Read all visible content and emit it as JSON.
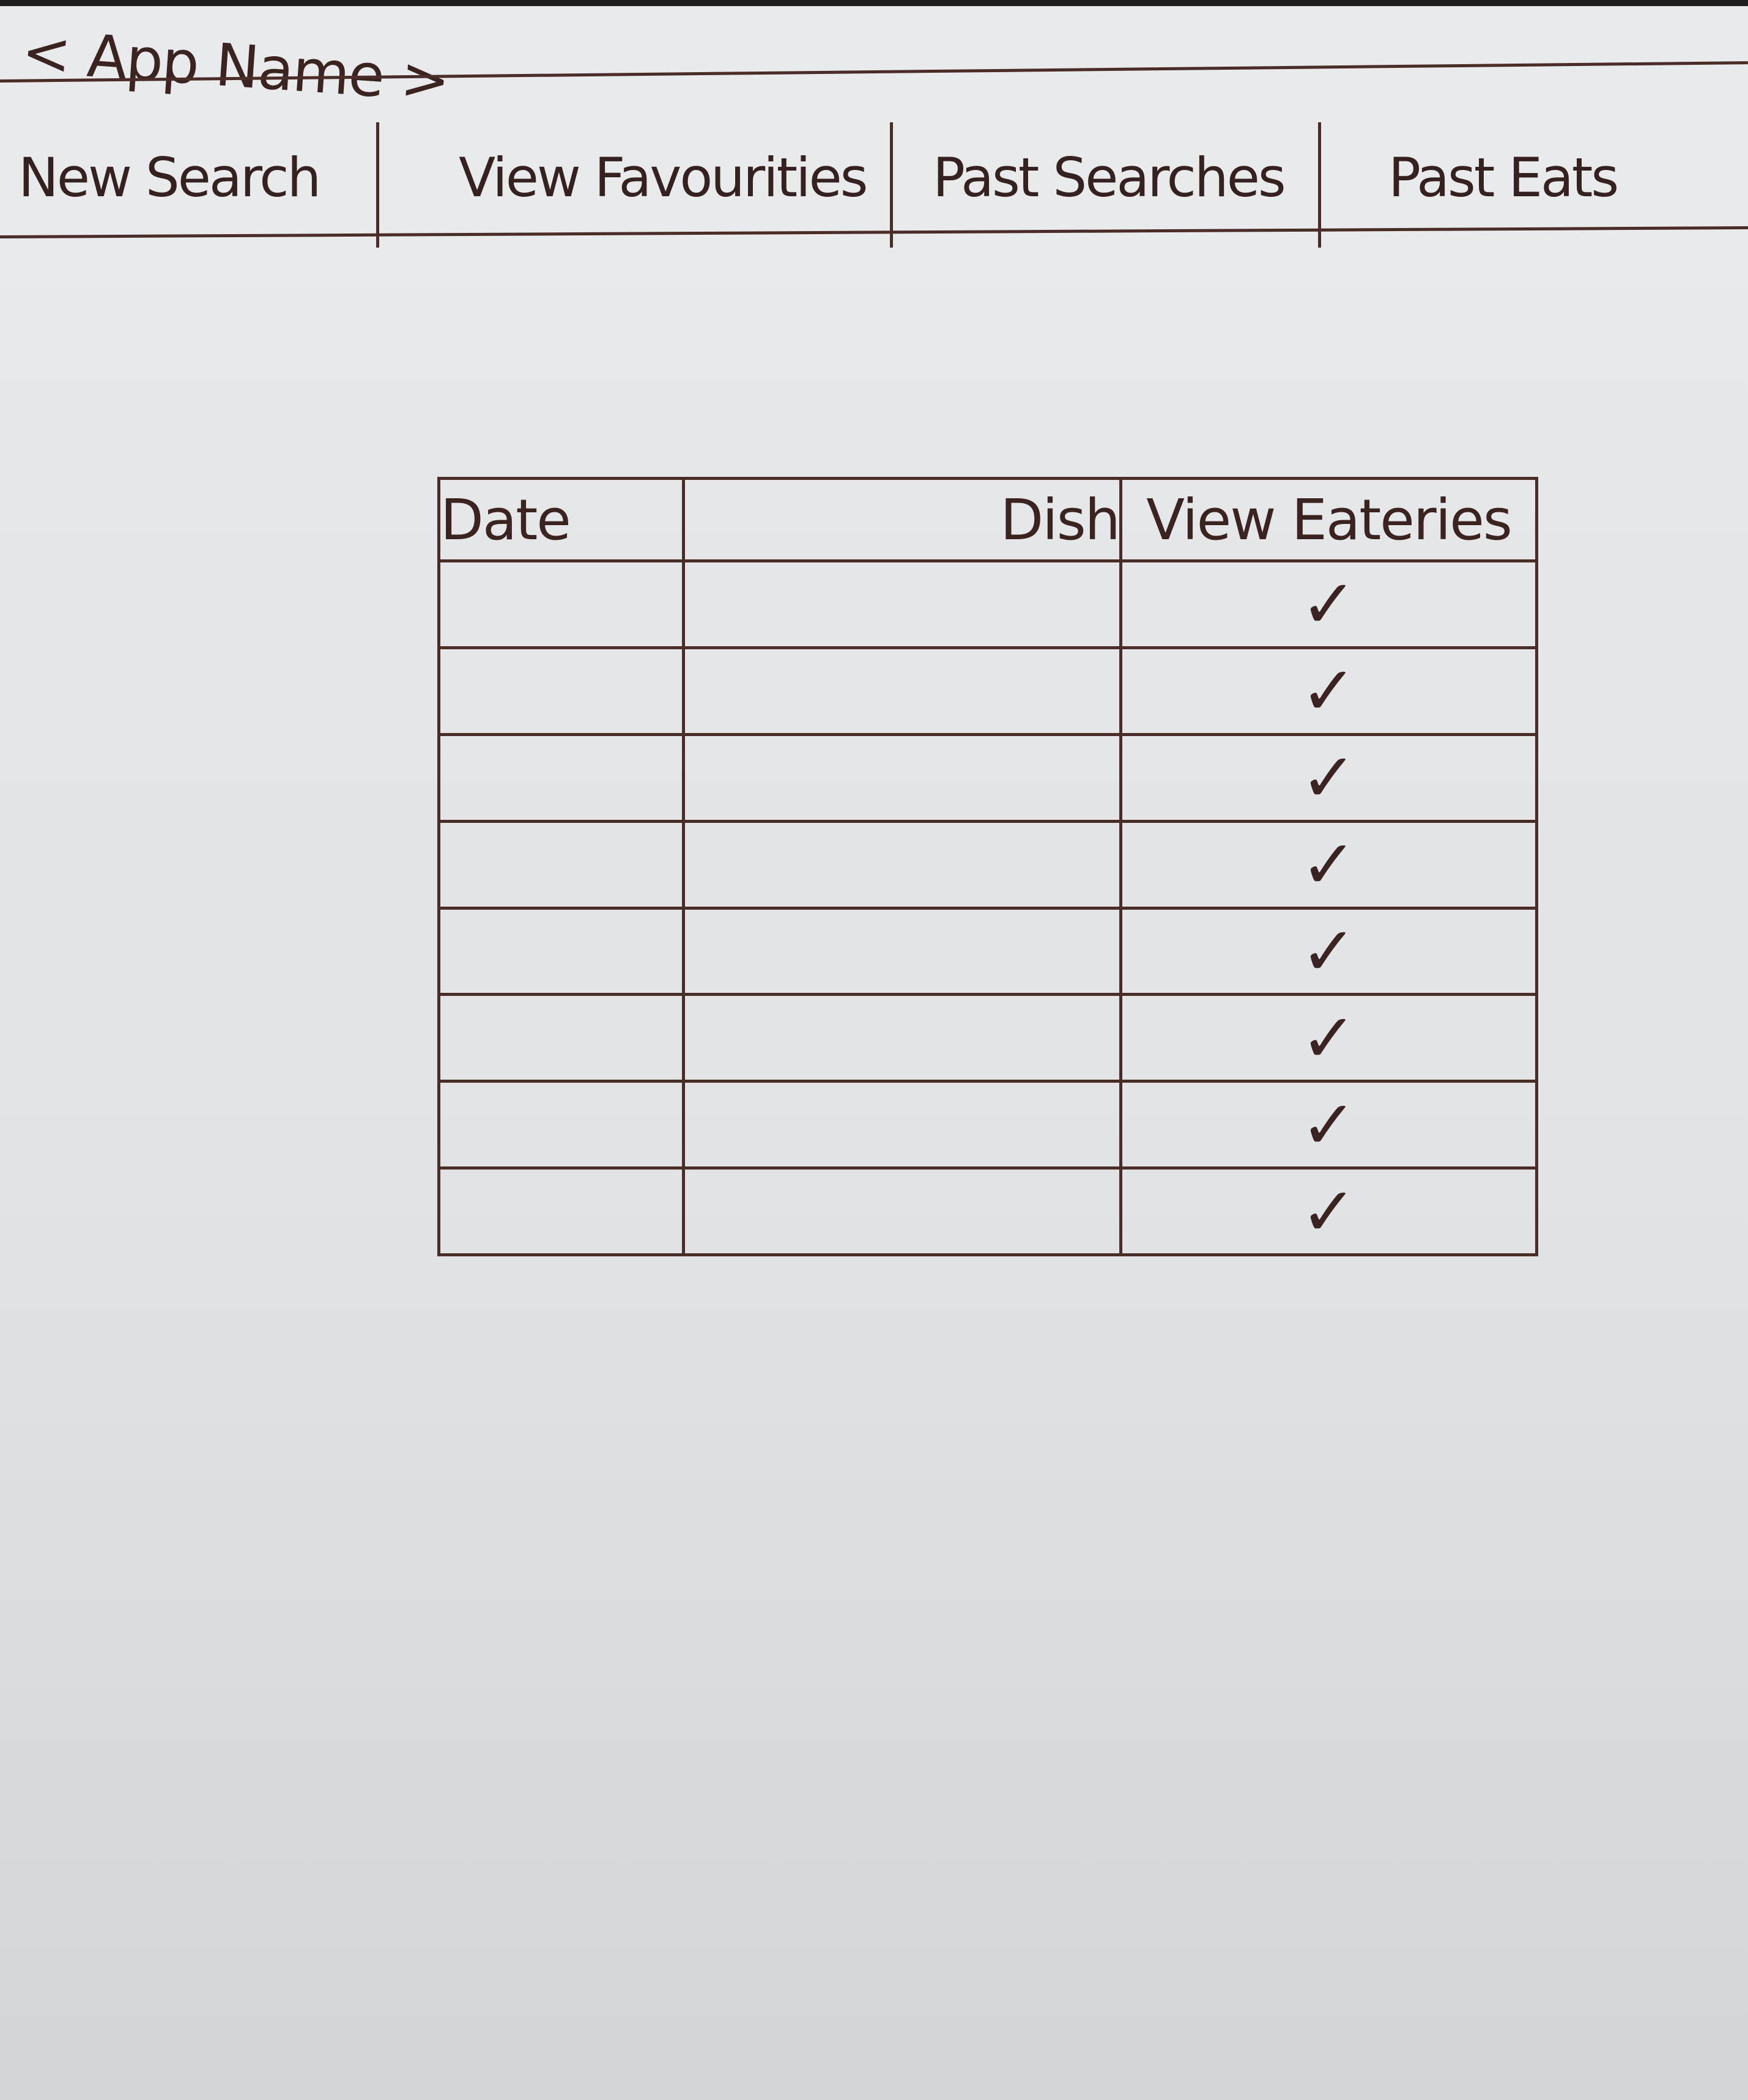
{
  "app": {
    "name": "< App Name >"
  },
  "nav": {
    "tabs": [
      {
        "label": "New Search"
      },
      {
        "label": "View Favourities"
      },
      {
        "label": "Past Searches"
      },
      {
        "label": "Past Eats"
      }
    ]
  },
  "table": {
    "headers": {
      "date": "Date",
      "dish": "Dish",
      "view": "View Eateries"
    },
    "rows": [
      {
        "date": "",
        "dish": "",
        "view": "✓"
      },
      {
        "date": "",
        "dish": "",
        "view": "✓"
      },
      {
        "date": "",
        "dish": "",
        "view": "✓"
      },
      {
        "date": "",
        "dish": "",
        "view": "✓"
      },
      {
        "date": "",
        "dish": "",
        "view": "✓"
      },
      {
        "date": "",
        "dish": "",
        "view": "✓"
      },
      {
        "date": "",
        "dish": "",
        "view": "✓"
      },
      {
        "date": "",
        "dish": "",
        "view": "✓"
      }
    ]
  }
}
